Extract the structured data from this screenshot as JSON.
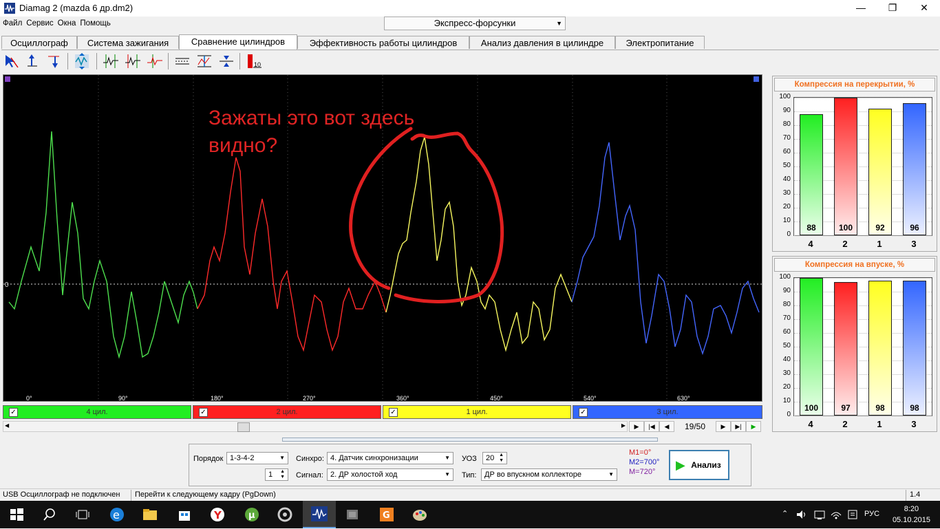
{
  "window": {
    "title": "Diamag 2 (mazda 6 др.dm2)",
    "minimize": "—",
    "maximize": "❐",
    "close": "✕"
  },
  "menu": [
    "Файл",
    "Сервис",
    "Окна",
    "Помощь"
  ],
  "mode_select": "Экспресс-форсунки",
  "tabs": [
    "Осциллограф",
    "Система зажигания",
    "Сравнение цилиндров",
    "Эффективность работы цилиндров",
    "Анализ давления в цилиндре",
    "Электропитание"
  ],
  "active_tab": 2,
  "scope": {
    "annotation_line1": "Зажаты это вот здесь",
    "annotation_line2": "видно?",
    "zero_label": "0",
    "angles": [
      "0°",
      "90°",
      "180°",
      "270°",
      "360°",
      "450°",
      "540°",
      "630°"
    ],
    "toolbar_label_10": "10"
  },
  "cylinders": [
    {
      "label": "4 цил.",
      "color": "#22ee22"
    },
    {
      "label": "2 цил.",
      "color": "#ff2020"
    },
    {
      "label": "1 цил.",
      "color": "#ffff20"
    },
    {
      "label": "3 цил.",
      "color": "#3366ff"
    }
  ],
  "frame_counter": "19/50",
  "charts": [
    {
      "title": "Компрессия на перекрытии, %",
      "yticks": [
        "100",
        "90",
        "80",
        "70",
        "60",
        "50",
        "40",
        "30",
        "20",
        "10",
        "0"
      ],
      "categories": [
        "4",
        "2",
        "1",
        "3"
      ],
      "values": [
        88,
        100,
        92,
        96
      ],
      "labels": [
        "88",
        "100",
        "92",
        "96"
      ]
    },
    {
      "title": "Компрессия на впуске, %",
      "yticks": [
        "100",
        "90",
        "80",
        "70",
        "60",
        "50",
        "40",
        "30",
        "20",
        "10",
        "0"
      ],
      "categories": [
        "4",
        "2",
        "1",
        "3"
      ],
      "values": [
        100,
        97,
        98,
        98
      ],
      "labels": [
        "100",
        "97",
        "98",
        "98"
      ]
    }
  ],
  "chart_data": [
    {
      "type": "bar",
      "title": "Компрессия на перекрытии, %",
      "categories": [
        "4",
        "2",
        "1",
        "3"
      ],
      "values": [
        88,
        100,
        92,
        96
      ],
      "ylim": [
        0,
        100
      ],
      "colors": [
        "#22ee22",
        "#ff2020",
        "#ffff20",
        "#3366ff"
      ]
    },
    {
      "type": "bar",
      "title": "Компрессия на впуске, %",
      "categories": [
        "4",
        "2",
        "1",
        "3"
      ],
      "values": [
        100,
        97,
        98,
        98
      ],
      "ylim": [
        0,
        100
      ],
      "colors": [
        "#22ee22",
        "#ff2020",
        "#ffff20",
        "#3366ff"
      ]
    }
  ],
  "controls": {
    "order_label": "Порядок",
    "order_value": "1-3-4-2",
    "order_spin": "1",
    "sync_label": "Синхро:",
    "sync_value": "4.  Датчик синхронизации",
    "signal_label": "Сигнал:",
    "signal_value": "2.  ДР холостой ход",
    "uoz_label": "УОЗ",
    "uoz_value": "20",
    "type_label": "Тип:",
    "type_value": "ДР во впускном коллекторе",
    "m1": "M1=0°",
    "m2": "M2=700°",
    "m3": "M=720°",
    "analyze": "Анализ"
  },
  "status": {
    "usb": "USB Осциллограф не подключен",
    "hint": "Перейти к следующему кадру (PgDown)",
    "version": "1.4"
  },
  "taskbar": {
    "lang": "РУС",
    "time": "8:20",
    "date": "05.10.2015"
  }
}
